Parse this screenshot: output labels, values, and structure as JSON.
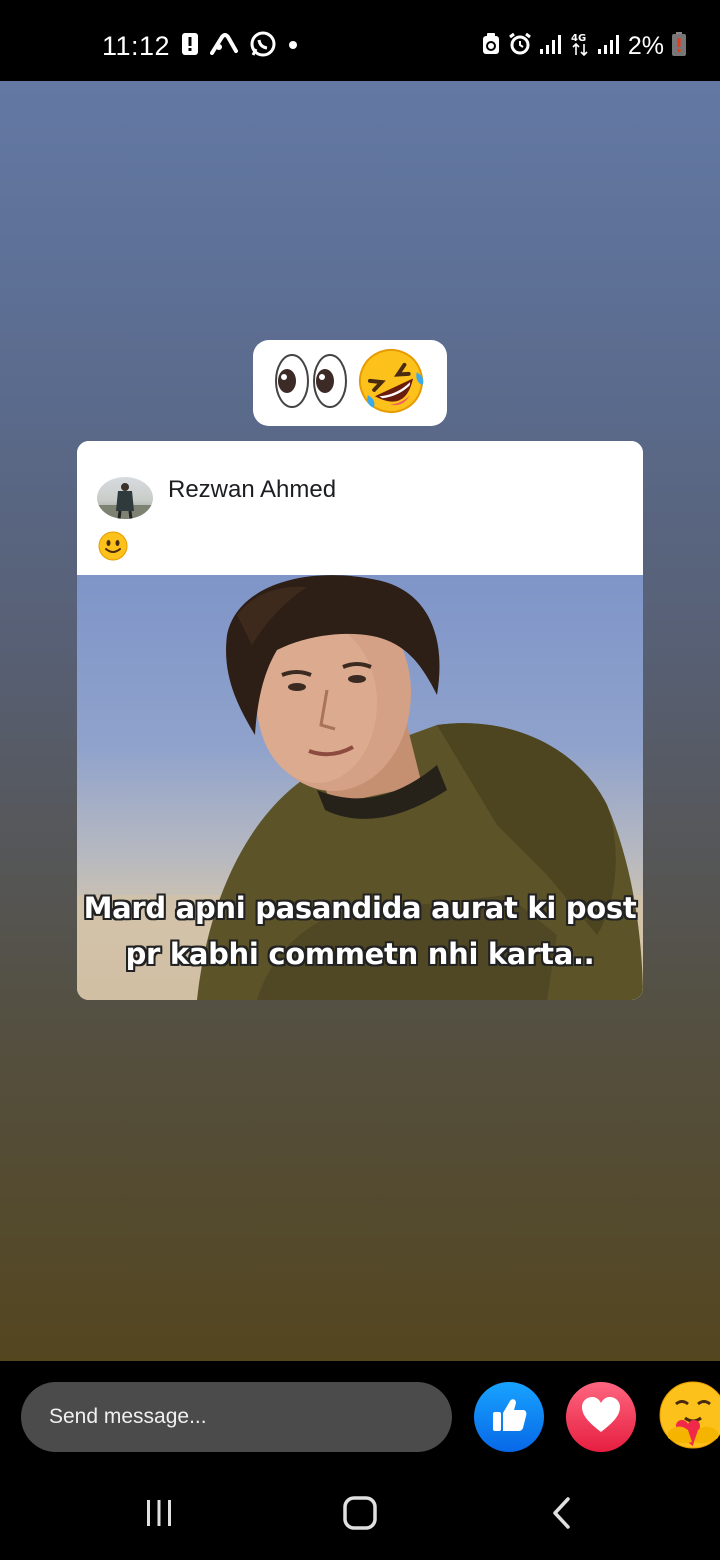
{
  "status_bar": {
    "time": "11:12",
    "battery_percent": "2%",
    "network_type": "4G",
    "left_icons": [
      "alert-icon",
      "telenor-icon",
      "whatsapp-icon",
      "dot-icon"
    ],
    "right_icons": [
      "recycle-icon",
      "alarm-icon",
      "signal-icon",
      "4g-icon",
      "signal-icon",
      "battery-icon"
    ]
  },
  "story": {
    "caption_emojis": [
      "👀",
      "🤣"
    ],
    "post": {
      "author_name": "Rezwan Ahmed",
      "post_emoji": "🙂",
      "meme_text_line_1": "Mard apni pasandida aurat ki post",
      "meme_text_line_2": "pr kabhi commetn nhi karta.."
    }
  },
  "reply_bar": {
    "placeholder": "Send message...",
    "reactions": [
      "like-icon",
      "love-icon",
      "care-icon"
    ]
  },
  "nav_bar": {
    "buttons": [
      "recent-apps-icon",
      "home-icon",
      "back-icon"
    ]
  },
  "colors": {
    "like_blue": "#0866ff",
    "love_red": "#f02849",
    "input_bg": "#4b4b4b"
  }
}
